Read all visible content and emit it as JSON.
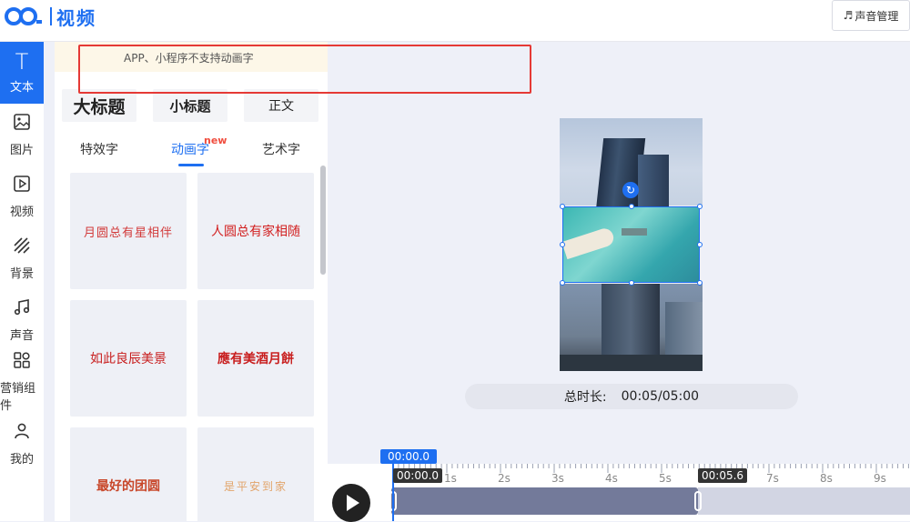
{
  "header": {
    "logo_text": "视频",
    "music_button": "声音管理"
  },
  "nav": {
    "items": [
      {
        "label": "文本",
        "icon": "text-icon"
      },
      {
        "label": "图片",
        "icon": "image-icon"
      },
      {
        "label": "视频",
        "icon": "video-icon"
      },
      {
        "label": "背景",
        "icon": "background-icon"
      },
      {
        "label": "声音",
        "icon": "music-icon"
      },
      {
        "label": "营销组件",
        "icon": "widgets-icon"
      },
      {
        "label": "我的",
        "icon": "user-icon"
      }
    ],
    "active": "文本"
  },
  "panel": {
    "notice": "APP、小程序不支持动画字",
    "headings": [
      "大标题",
      "小标题",
      "正文"
    ],
    "tabs": [
      "特效字",
      "动画字",
      "艺术字"
    ],
    "active_tab": "动画字",
    "new_badge": "new",
    "cards": [
      {
        "text": "月圆总有星相伴",
        "color": "#d23a3a"
      },
      {
        "text": "人圆总有家相随",
        "color": "#d21f1f"
      },
      {
        "text": "如此良辰美景",
        "color": "#c81e1e"
      },
      {
        "text": "應有美酒月餅",
        "color": "#c81e1e"
      },
      {
        "text": "最好的团圆",
        "color": "#c8472a"
      },
      {
        "text": "是平安到家",
        "color": "#e2a46a"
      }
    ]
  },
  "preview": {
    "duration_label": "总时长:",
    "duration_value": "00:05/05:00"
  },
  "timeline": {
    "current_time": "00:00.0",
    "current_time_inline": "00:00.0",
    "clip_end": "00:05.6",
    "ticks": [
      "1s",
      "2s",
      "3s",
      "4s",
      "5s",
      "7s",
      "8s",
      "9s"
    ]
  },
  "colors": {
    "accent": "#1e6ff1",
    "notice_border": "#e53935"
  }
}
